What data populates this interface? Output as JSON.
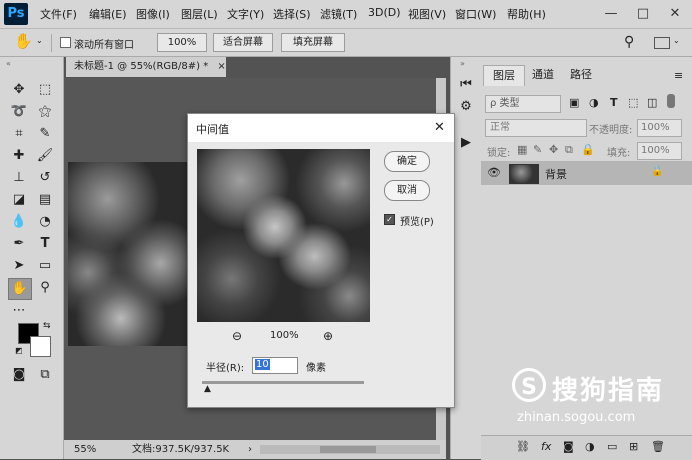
{
  "app": {
    "logo": "Ps"
  },
  "menu": [
    "文件(F)",
    "编辑(E)",
    "图像(I)",
    "图层(L)",
    "文字(Y)",
    "选择(S)",
    "滤镜(T)",
    "3D(D)",
    "视图(V)",
    "窗口(W)",
    "帮助(H)"
  ],
  "window_controls": {
    "minimize": "—",
    "maximize": "□",
    "close": "✕"
  },
  "options": {
    "scroll_all_label": "滚动所有窗口",
    "zoom_100": "100%",
    "fit_screen": "适合屏幕",
    "fill_screen": "填充屏幕"
  },
  "document": {
    "tab_title": "未标题-1 @ 55%(RGB/8#) *",
    "tab_close": "×",
    "zoom": "55%",
    "doc_size": "文档:937.5K/937.5K"
  },
  "dialog": {
    "title": "中间值",
    "close": "✕",
    "ok": "确定",
    "cancel": "取消",
    "preview_label": "预览(P)",
    "preview_checked": true,
    "zoom_level": "100%",
    "radius_label": "半径(R):",
    "radius_value": "10",
    "radius_unit": "像素"
  },
  "layers_panel": {
    "tabs": [
      "图层",
      "通道",
      "路径"
    ],
    "filter_kind": "ρ 类型",
    "blend_mode": "正常",
    "opacity_label": "不透明度:",
    "opacity_value": "100%",
    "lock_label": "锁定:",
    "fill_label": "填充:",
    "fill_value": "100%",
    "layer_name": "背景"
  },
  "watermark": {
    "brand": "搜狗指南",
    "url": "zhinan.sogou.com"
  }
}
